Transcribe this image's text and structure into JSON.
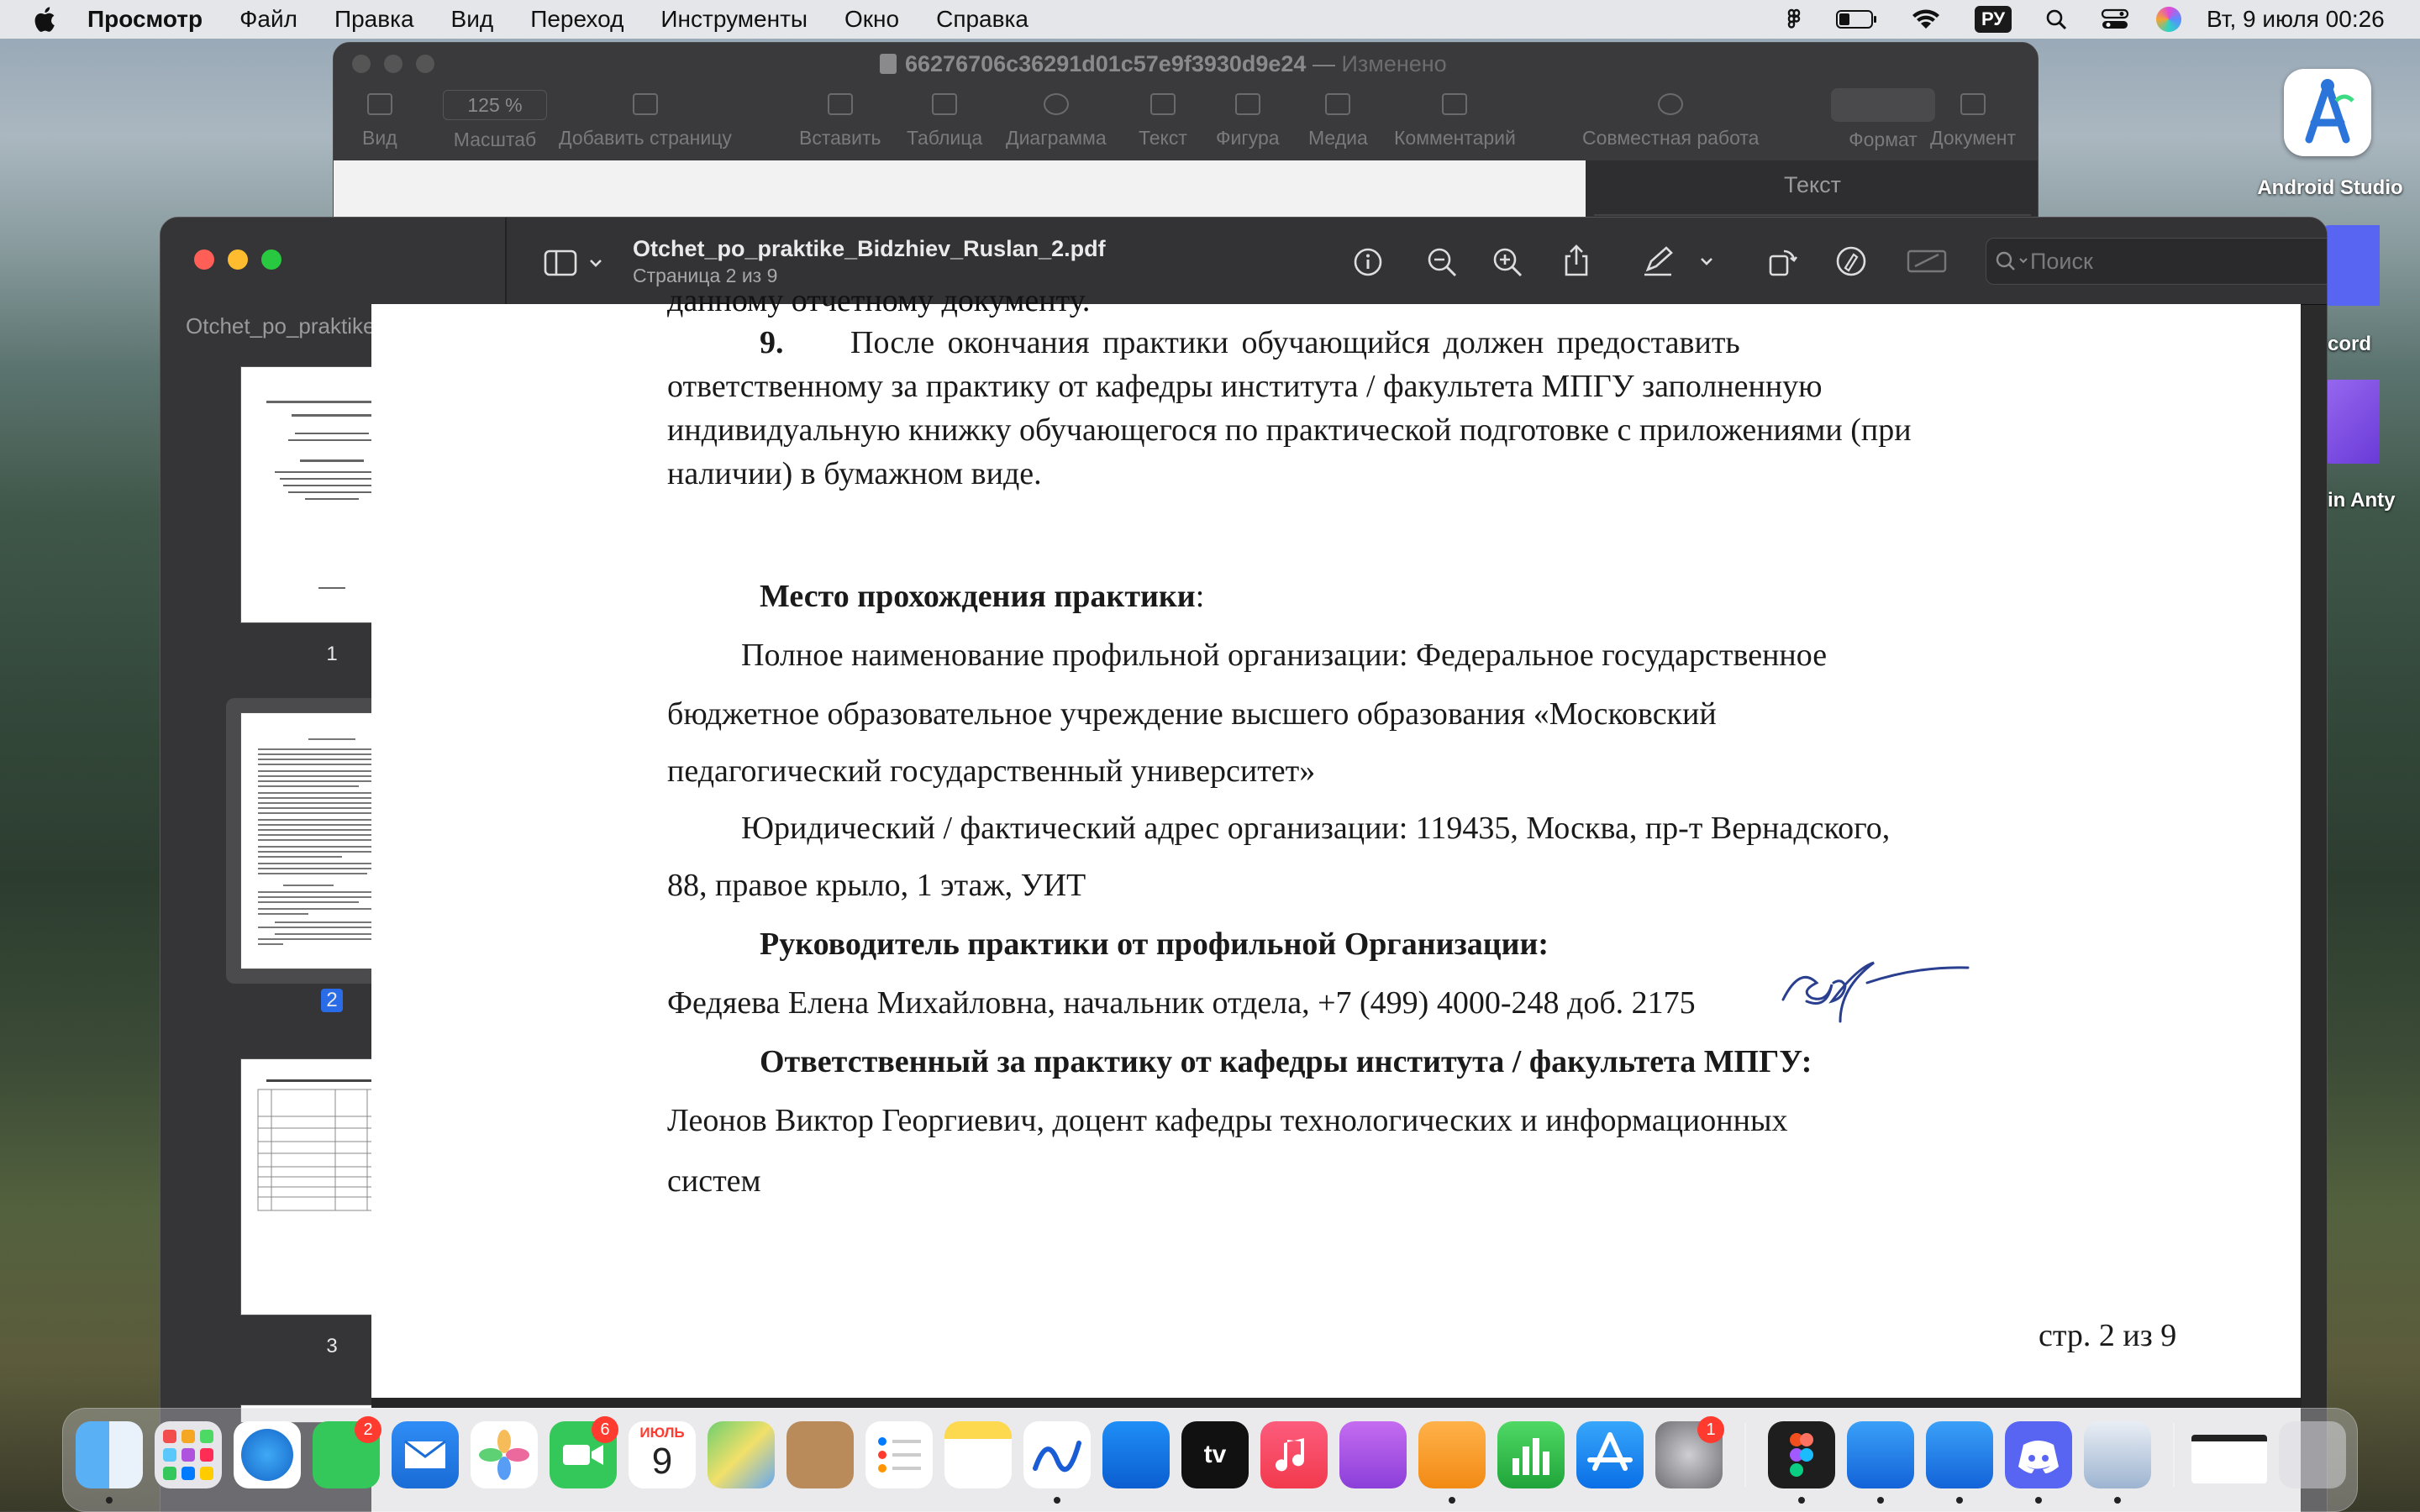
{
  "menubar": {
    "app": "Просмотр",
    "items": [
      "Файл",
      "Правка",
      "Вид",
      "Переход",
      "Инструменты",
      "Окно",
      "Справка"
    ],
    "input_lang": "РУ",
    "datetime": "Вт, 9 июля  00:26"
  },
  "pages_window": {
    "title": "66276706c36291d01c57e9f3930d9e24",
    "title_sep": " — ",
    "status": "Изменено",
    "zoom": "125 %",
    "toolbar": [
      {
        "icon": "view-icon",
        "label": "Вид"
      },
      {
        "icon": "zoom-icon",
        "label": "Масштаб"
      },
      {
        "icon": "add-page-icon",
        "label": "Добавить страницу"
      },
      {
        "icon": "insert-icon",
        "label": "Вставить"
      },
      {
        "icon": "table-icon",
        "label": "Таблица"
      },
      {
        "icon": "chart-icon",
        "label": "Диаграмма"
      },
      {
        "icon": "text-icon",
        "label": "Текст"
      },
      {
        "icon": "shape-icon",
        "label": "Фигура"
      },
      {
        "icon": "media-icon",
        "label": "Медиа"
      },
      {
        "icon": "comment-icon",
        "label": "Комментарий"
      },
      {
        "icon": "collaborate-icon",
        "label": "Совместная работа"
      },
      {
        "icon": "format-icon",
        "label": "Формат"
      },
      {
        "icon": "document-icon",
        "label": "Документ"
      }
    ],
    "inspector_tab": "Текст"
  },
  "preview_window": {
    "filename": "Otchet_po_praktike_Bidzhiev_Ruslan_2.pdf",
    "page_status": "Страница 2 из 9",
    "sidebar_title": "Otchet_po_praktike_Bid...",
    "search_placeholder": "Поиск",
    "thumbnails": [
      {
        "label": "1"
      },
      {
        "label": "2",
        "selected": true
      },
      {
        "label": "3"
      }
    ]
  },
  "document": {
    "partial_top": "данному отчетному документу.",
    "p9_num": "9.",
    "p9_l1": "После    окончания    практики    обучающийся    должен    предоставить",
    "p9_l2": "ответственному за практику от кафедры института / факультета МПГУ заполненную",
    "p9_l3": "индивидуальную книжку обучающегося по практической подготовке с приложениями (при",
    "p9_l4": "наличии) в бумажном виде.",
    "place_heading": "Место прохождения практики",
    "place_colon": ":",
    "org_l1": "Полное наименование профильной организации: Федеральное государственное",
    "org_l2": "бюджетное образовательное учреждение высшего образования «Московский",
    "org_l3": "педагогический государственный университет»",
    "addr_l1": "Юридический / фактический адрес организации: 119435, Москва, пр-т Вернадского,",
    "addr_l2": "88, правое крыло, 1 этаж, УИТ",
    "head_org": "Руководитель практики от профильной Организации:",
    "head_org_person": "Федяева Елена Михайловна, начальник отдела, +7 (499) 4000-248 доб. 2175",
    "resp_heading": "Ответственный за практику от кафедры института / факультета МПГУ:",
    "resp_l1": "Леонов Виктор Георгиевич, доцент кафедры технологических и информационных",
    "resp_l2": "систем",
    "page_footer": "стр. 2 из 9"
  },
  "desktop_icons": [
    {
      "label": "Android Studio"
    },
    {
      "label": "cord"
    },
    {
      "label": "in Anty"
    }
  ],
  "dock": {
    "badges": {
      "messages": "2",
      "facetime": "6",
      "settings": "1"
    },
    "calendar_month": "ИЮЛЬ",
    "calendar_day": "9",
    "tv_label": "tv"
  },
  "colors": {
    "selection": "#2a6be8",
    "close": "#ff5f57",
    "minimize": "#febc2e",
    "zoom": "#28c840"
  }
}
